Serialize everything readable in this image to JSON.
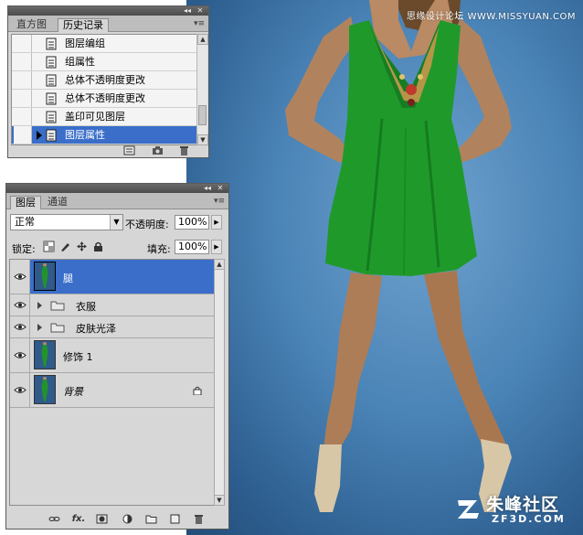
{
  "history_panel": {
    "collapse_glyph": "◂◂",
    "close_glyph": "✕",
    "menu_glyph": "▾≡",
    "tabs": [
      {
        "label": "直方图",
        "active": false
      },
      {
        "label": "历史记录",
        "active": true
      }
    ],
    "items": [
      {
        "label": "图层编组",
        "selected": false
      },
      {
        "label": "组属性",
        "selected": false
      },
      {
        "label": "总体不透明度更改",
        "selected": false
      },
      {
        "label": "总体不透明度更改",
        "selected": false
      },
      {
        "label": "盖印可见图层",
        "selected": false
      },
      {
        "label": "图层属性",
        "selected": true
      }
    ],
    "footer_icons": [
      "new-document-from-state-icon",
      "snapshot-camera-icon",
      "trash-icon"
    ]
  },
  "layers_panel": {
    "collapse_glyph": "◂◂",
    "close_glyph": "✕",
    "menu_glyph": "▾≡",
    "tabs": [
      {
        "label": "图层",
        "active": true
      },
      {
        "label": "通道",
        "active": false
      }
    ],
    "blend_mode": "正常",
    "opacity_label": "不透明度:",
    "opacity_value": "100%",
    "lock_label": "锁定:",
    "fill_label": "填充:",
    "fill_value": "100%",
    "layers": [
      {
        "name": "腿",
        "type": "pixel",
        "visible": true,
        "selected": true
      },
      {
        "name": "衣服",
        "type": "group",
        "visible": true,
        "selected": false
      },
      {
        "name": "皮肤光泽",
        "type": "group",
        "visible": true,
        "selected": false
      },
      {
        "name": "修饰 1",
        "type": "pixel",
        "visible": true,
        "selected": false
      },
      {
        "name": "背景",
        "type": "background",
        "visible": true,
        "selected": false,
        "locked": true
      }
    ],
    "footer_icons": [
      "link-layers-icon",
      "layer-style-fx-icon",
      "layer-mask-icon",
      "adjustment-layer-icon",
      "new-group-icon",
      "new-layer-icon",
      "trash-icon"
    ],
    "fx_glyph": "fx."
  },
  "watermarks": {
    "top": "思缘设计论坛  WWW.MISSYUAN.COM",
    "bottom_name": "朱峰社区",
    "bottom_domain": "ZF3D.COM"
  },
  "colors": {
    "selection_blue": "#3a6ec9",
    "panel_gray": "#d6d6d6",
    "backdrop_blue": "#4a83b6",
    "dress_green": "#1f9a2a"
  }
}
